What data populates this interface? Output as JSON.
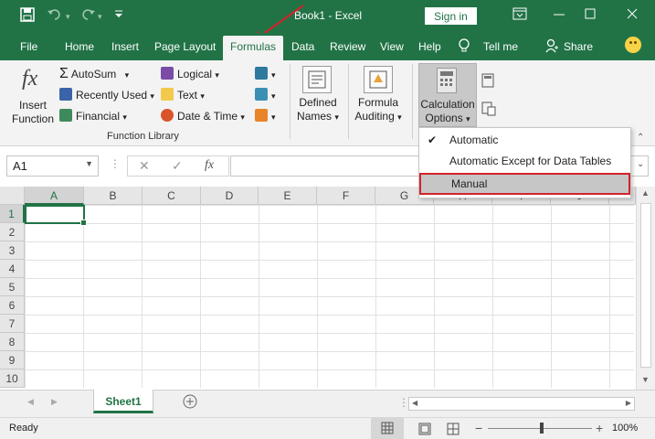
{
  "titlebar": {
    "title": "Book1  -  Excel",
    "signin": "Sign in",
    "icons": [
      "save-icon",
      "undo-icon",
      "redo-icon",
      "customize-qat-icon",
      "ribbon-display-icon",
      "minimize-icon",
      "restore-icon",
      "close-icon"
    ]
  },
  "tabs": [
    {
      "label": "File"
    },
    {
      "label": "Home"
    },
    {
      "label": "Insert"
    },
    {
      "label": "Page Layout"
    },
    {
      "label": "Formulas"
    },
    {
      "label": "Data"
    },
    {
      "label": "Review"
    },
    {
      "label": "View"
    },
    {
      "label": "Help"
    }
  ],
  "tellme": "Tell me",
  "share": "Share",
  "ribbon": {
    "insert_function": [
      "Insert",
      "Function"
    ],
    "autosum": "AutoSum",
    "recently_used": "Recently Used",
    "financial": "Financial",
    "logical": "Logical",
    "text": "Text",
    "datetime": "Date & Time",
    "group_label": "Function Library",
    "defined_names": [
      "Defined",
      "Names"
    ],
    "formula_auditing": [
      "Formula",
      "Auditing"
    ],
    "calculation_options": [
      "Calculation",
      "Options"
    ],
    "fx_glyph": "fx"
  },
  "calc_menu": {
    "items": [
      {
        "label": "Automatic",
        "checked": true
      },
      {
        "label": "Automatic Except for Data Tables",
        "checked": false
      },
      {
        "label": "Manual",
        "checked": false,
        "highlighted": true
      }
    ]
  },
  "formula_bar": {
    "namebox": "A1",
    "fx": "fx",
    "value": ""
  },
  "grid": {
    "columns": [
      "A",
      "B",
      "C",
      "D",
      "E",
      "F",
      "G",
      "H",
      "I",
      "J"
    ],
    "rows": [
      "1",
      "2",
      "3",
      "4",
      "5",
      "6",
      "7",
      "8",
      "9",
      "10"
    ],
    "active_cell": "A1"
  },
  "sheets": [
    "Sheet1"
  ],
  "status": {
    "text": "Ready",
    "zoom": "100%"
  },
  "colors": {
    "excel_green": "#217346",
    "highlight_red": "#d2232a",
    "annotation_arrow": "#d2232a"
  }
}
